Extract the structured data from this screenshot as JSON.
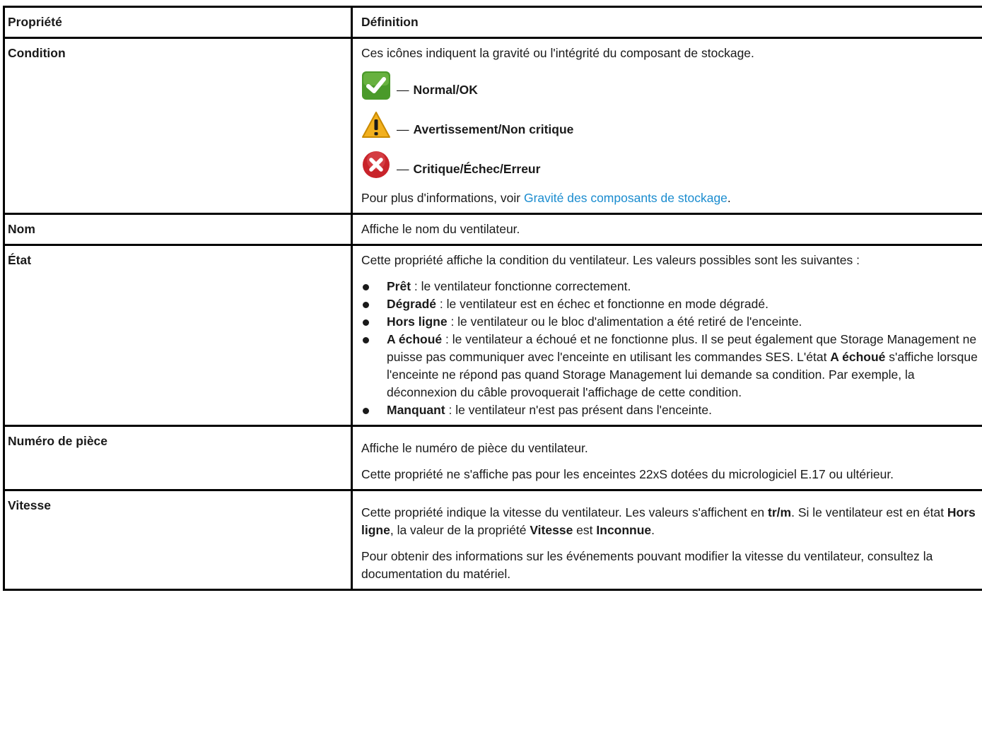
{
  "header": {
    "col1": "Propriété",
    "col2": "Définition"
  },
  "condition": {
    "name": "Condition",
    "intro": "Ces icônes indiquent la gravité ou l'intégrité du composant de stockage.",
    "legend": [
      {
        "icon": "checkmark-icon",
        "dash": "—",
        "label": "Normal/OK"
      },
      {
        "icon": "warning-icon",
        "dash": "—",
        "label": "Avertissement/Non critique"
      },
      {
        "icon": "error-icon",
        "dash": "—",
        "label": "Critique/Échec/Erreur"
      }
    ],
    "more_prefix": "Pour plus d'informations, voir ",
    "more_link": "Gravité des composants de stockage",
    "more_suffix": "."
  },
  "nom": {
    "name": "Nom",
    "text": "Affiche le nom du ventilateur."
  },
  "etat": {
    "name": "État",
    "intro": "Cette propriété affiche la condition du ventilateur. Les valeurs possibles sont les suivantes :",
    "items": [
      {
        "term": "Prêt",
        "text": " : le ventilateur fonctionne correctement."
      },
      {
        "term": "Dégradé",
        "text": " : le ventilateur est en échec et fonctionne en mode dégradé."
      },
      {
        "term": "Hors ligne",
        "text": " : le ventilateur ou le bloc d'alimentation a été retiré de l'enceinte."
      },
      {
        "term": "A échoué",
        "text": " : le ventilateur a échoué et ne fonctionne plus. Il se peut également que Storage Management ne puisse pas communiquer avec l'enceinte en utilisant les commandes SES. L'état ",
        "term2": "A échoué",
        "text2": " s'affiche lorsque l'enceinte ne répond pas quand Storage Management lui demande sa condition. Par exemple, la déconnexion du câble provoquerait l'affichage de cette condition."
      },
      {
        "term": "Manquant",
        "text": " : le ventilateur n'est pas présent dans l'enceinte."
      }
    ]
  },
  "numero": {
    "name": "Numéro de pièce",
    "p1": "Affiche le numéro de pièce du ventilateur.",
    "p2": "Cette propriété ne s'affiche pas pour les enceintes 22xS dotées du micrologiciel E.17 ou ultérieur."
  },
  "vitesse": {
    "name": "Vitesse",
    "p1_a": "Cette propriété indique la vitesse du ventilateur. Les valeurs s'affichent en ",
    "p1_b": "tr/m",
    "p1_c": ". Si le ventilateur est en état ",
    "p1_d": "Hors ligne",
    "p1_e": ", la valeur de la propriété ",
    "p1_f": "Vitesse",
    "p1_g": " est ",
    "p1_h": "Inconnue",
    "p1_i": ".",
    "p2": "Pour obtenir des informations sur les événements pouvant modifier la vitesse du ventilateur, consultez la documentation du matériel."
  },
  "colors": {
    "link": "#1a8ccf",
    "ok_green": "#4a9a2a",
    "warning_yellow": "#f2b01e",
    "error_red": "#c8232a"
  }
}
